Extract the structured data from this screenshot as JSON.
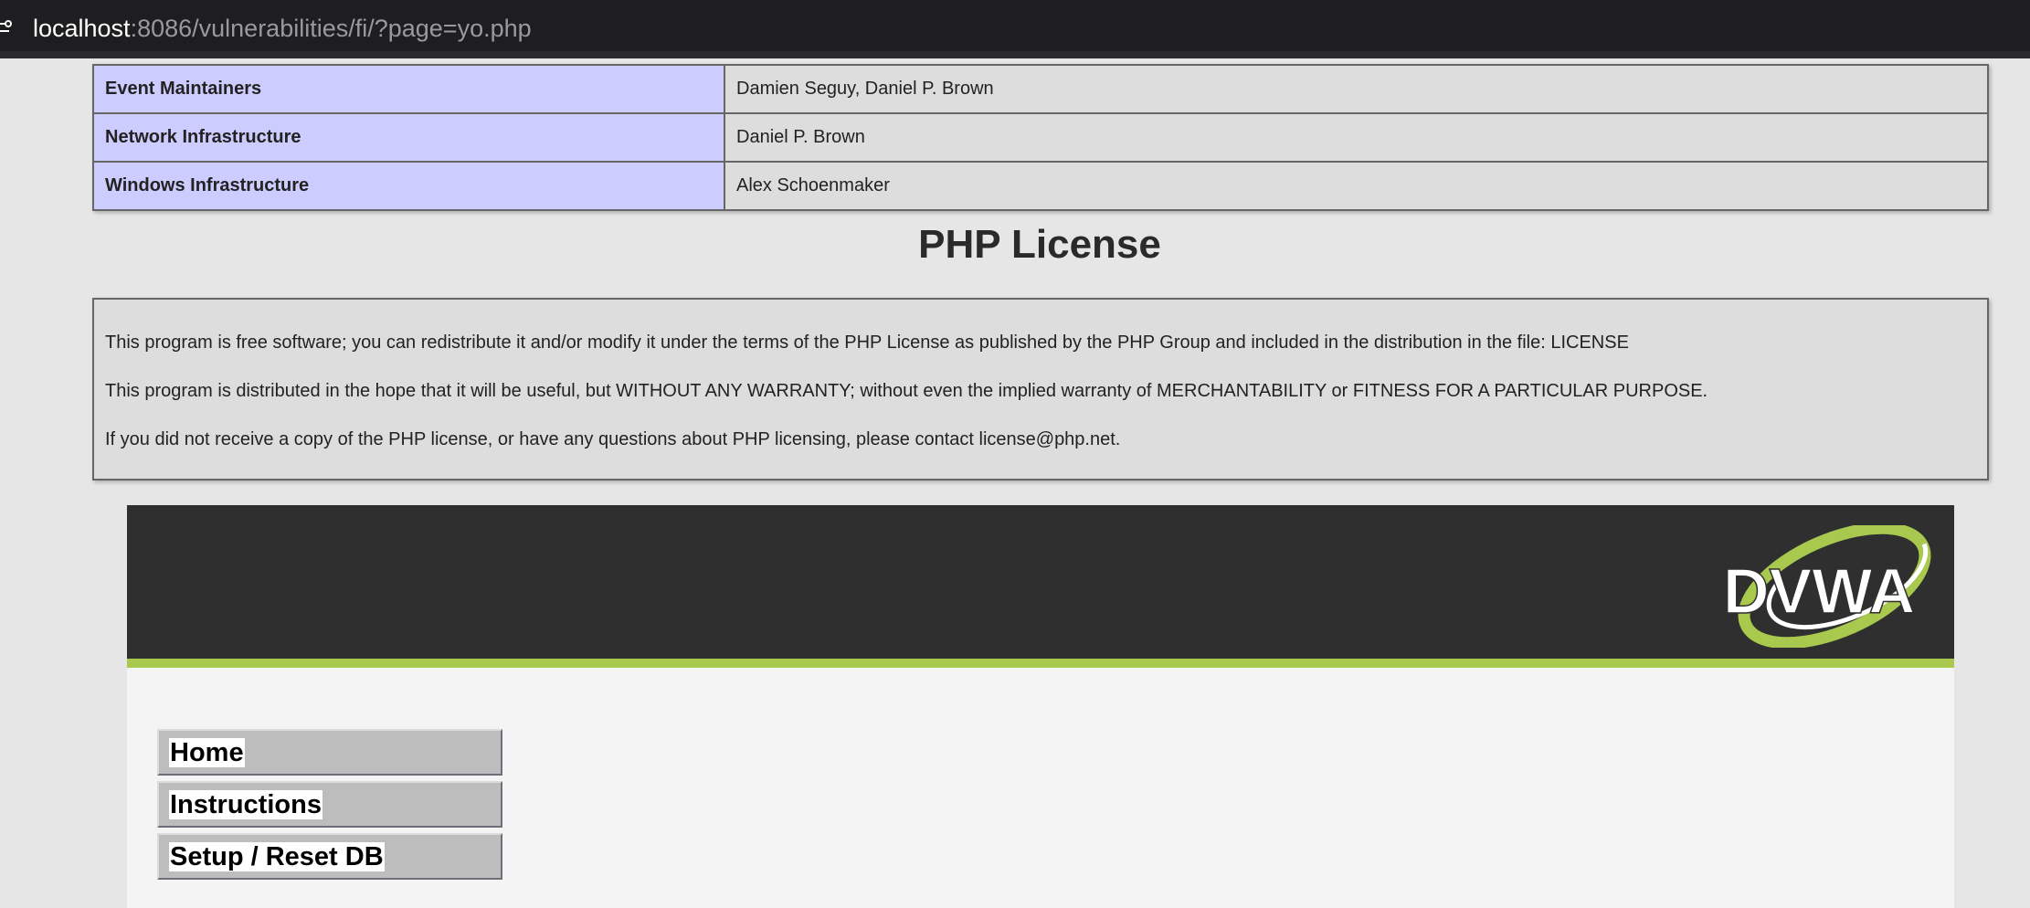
{
  "browser": {
    "url_host": "localhost",
    "url_rest": ":8086/vulnerabilities/fi/?page=yo.php"
  },
  "credits": [
    {
      "role": "Event Maintainers",
      "names": "Damien Seguy, Daniel P. Brown"
    },
    {
      "role": "Network Infrastructure",
      "names": "Daniel P. Brown"
    },
    {
      "role": "Windows Infrastructure",
      "names": "Alex Schoenmaker"
    }
  ],
  "license": {
    "title": "PHP License",
    "paragraphs": [
      "This program is free software; you can redistribute it and/or modify it under the terms of the PHP License as published by the PHP Group and included in the distribution in the file: LICENSE",
      "This program is distributed in the hope that it will be useful, but WITHOUT ANY WARRANTY; without even the implied warranty of MERCHANTABILITY or FITNESS FOR A PARTICULAR PURPOSE.",
      "If you did not receive a copy of the PHP license, or have any questions about PHP licensing, please contact license@php.net."
    ]
  },
  "dvwa": {
    "logo_text": "DVWA",
    "accent_color": "#a8c94e",
    "menu": [
      {
        "label": "Home"
      },
      {
        "label": "Instructions"
      },
      {
        "label": "Setup / Reset DB"
      }
    ]
  }
}
